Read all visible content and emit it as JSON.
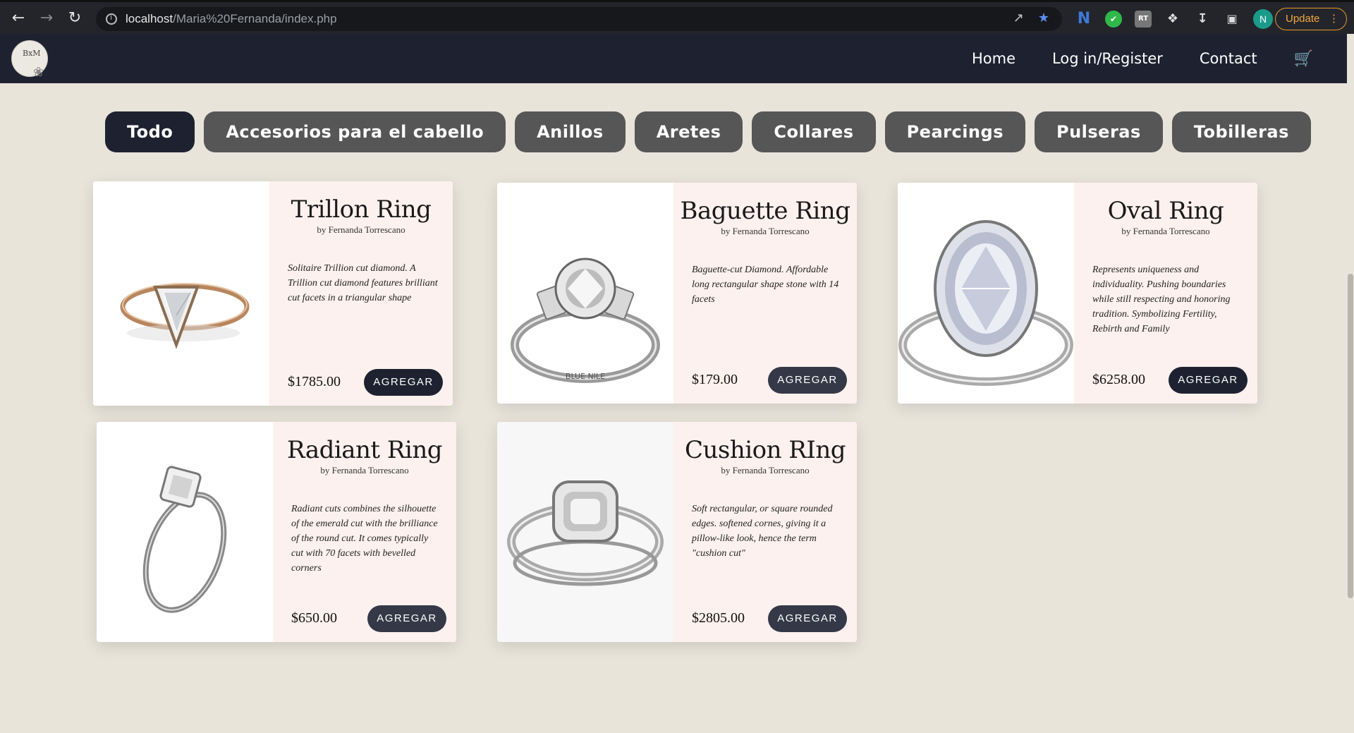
{
  "browser": {
    "url_host": "localhost",
    "url_path": "/Maria%20Fernanda/index.php",
    "update_label": "Update",
    "profile_initial": "N"
  },
  "nav": {
    "logo_text": "BxM",
    "links": [
      "Home",
      "Log in/Register",
      "Contact"
    ]
  },
  "filters": [
    "Todo",
    "Accesorios para el cabello",
    "Anillos",
    "Aretes",
    "Collares",
    "Pearcings",
    "Pulseras",
    "Tobilleras"
  ],
  "products": [
    {
      "name": "Trillon Ring",
      "by": "by Fernanda Torrescano",
      "description": "Solitaire Trillion cut diamond. A Trillion cut diamond features brilliant cut facets in a triangular shape",
      "price": "$1785.00",
      "button": "AGREGAR"
    },
    {
      "name": "Baguette Ring",
      "by": "by Fernanda Torrescano",
      "description": "Baguette-cut Diamond. Affordable long rectangular shape stone with 14 facets",
      "price": "$179.00",
      "button": "AGREGAR"
    },
    {
      "name": "Oval Ring",
      "by": "by Fernanda Torrescano",
      "description": "Represents uniqueness and individuality. Pushing boundaries while still respecting and honoring tradition. Symbolizing Fertility, Rebirth and Family",
      "price": "$6258.00",
      "button": "AGREGAR"
    },
    {
      "name": "Radiant Ring",
      "by": "by Fernanda Torrescano",
      "description": "Radiant cuts combines the silhouette of the emerald cut with the brilliance of the round cut. It comes typically cut with 70 facets with bevelled corners",
      "price": "$650.00",
      "button": "AGREGAR"
    },
    {
      "name": "Cushion RIng",
      "by": "by Fernanda Torrescano",
      "description": "Soft rectangular, or square rounded edges. softened cornes, giving it a pillow-like look, hence the term \"cushion cut\"",
      "price": "$2805.00",
      "button": "AGREGAR"
    }
  ],
  "colors": {
    "page_bg": "#e8e4da",
    "nav_bg": "#1e2230",
    "pill": "#565656",
    "card_info_bg": "#fcf1ee"
  }
}
